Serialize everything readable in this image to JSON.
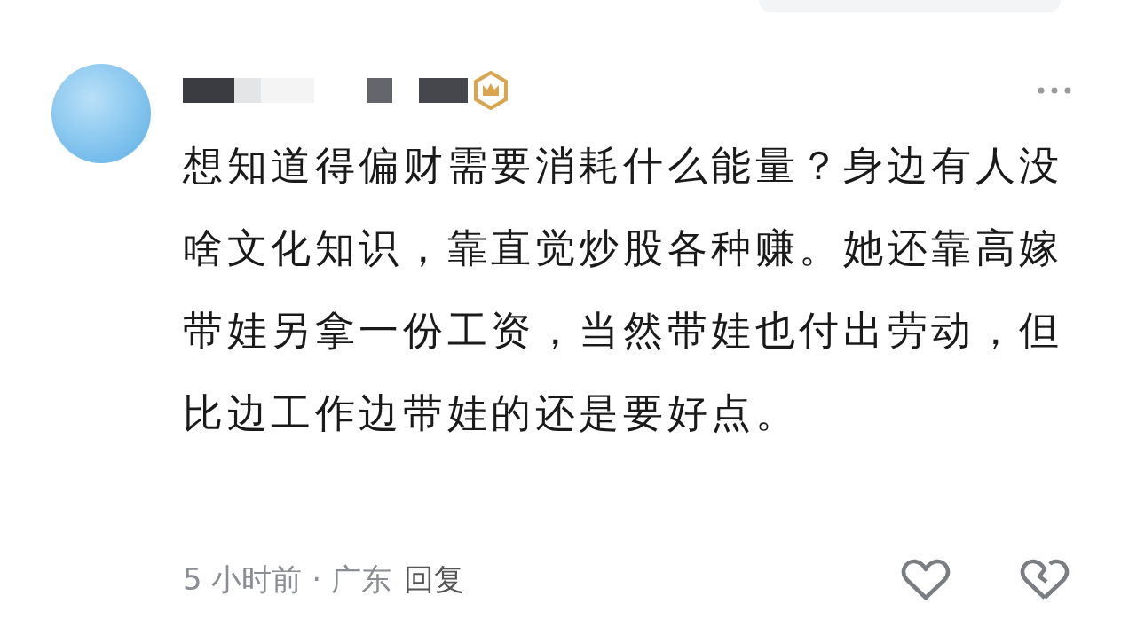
{
  "comment": {
    "text": "想知道得偏财需要消耗什么能量？身边有人没啥文化知识，靠直觉炒股各种赚。她还靠高嫁带娃另拿一份工资，当然带娃也付出劳动，但比边工作边带娃的还是要好点。",
    "meta": "5 小时前 · 广东",
    "reply": "回复"
  }
}
